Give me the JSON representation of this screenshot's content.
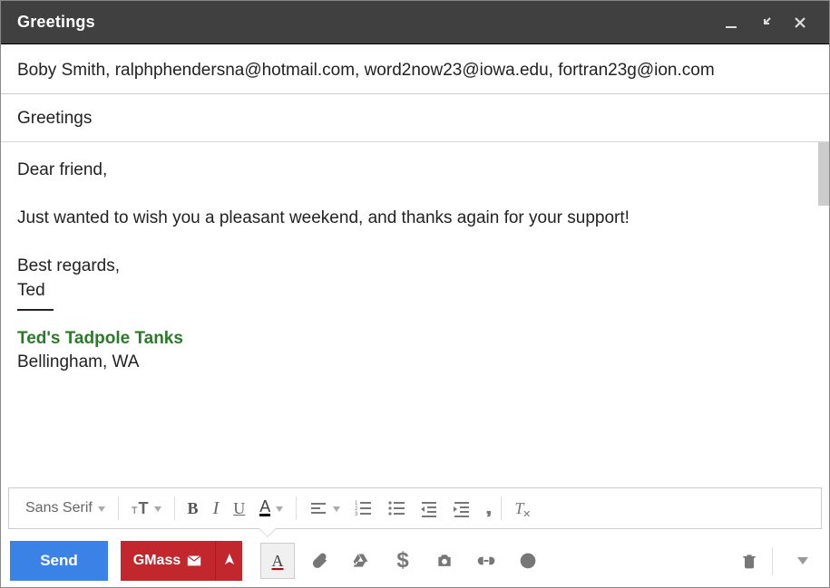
{
  "window": {
    "title": "Greetings"
  },
  "recipients": "Boby Smith, ralphphendersna@hotmail.com, word2now23@iowa.edu, fortran23g@ion.com",
  "subject": "Greetings",
  "body": {
    "line1": "Dear friend,",
    "line2": "Just wanted to wish you a pleasant weekend, and thanks again for your support!",
    "line3": "Best regards,",
    "line4": "Ted",
    "sig_name": "Ted's Tadpole Tanks",
    "sig_loc": "Bellingham, WA"
  },
  "format": {
    "font": "Sans Serif",
    "bold": "B",
    "italic": "I",
    "underline": "U",
    "quote": "❝❞"
  },
  "actions": {
    "send": "Send",
    "gmass": "GMass",
    "dollar": "$"
  }
}
